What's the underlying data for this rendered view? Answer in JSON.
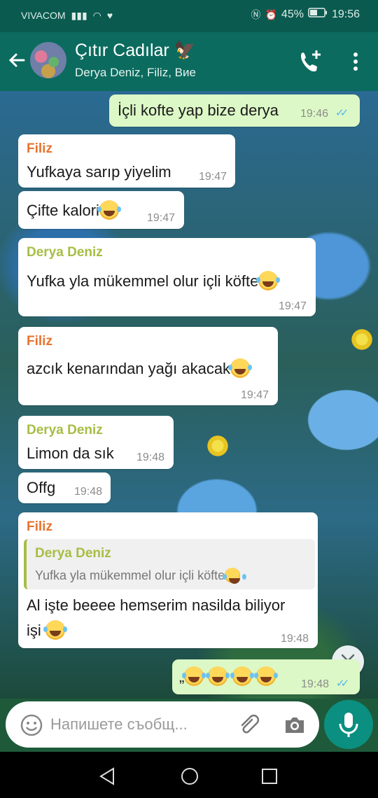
{
  "status_bar": {
    "carrier": "VIVACOM",
    "battery": "45%",
    "time": "19:56"
  },
  "header": {
    "title": "Çıtır Cadılar 🦅",
    "subtitle": "Derya Deniz, Filiz, Вие"
  },
  "messages": [
    {
      "type": "out",
      "text": "İçli kofte yap bize derya",
      "time": "19:46"
    },
    {
      "type": "in",
      "sender": "Filiz",
      "text": "Yufkaya sarıp yiyelim",
      "time": "19:47"
    },
    {
      "type": "in",
      "text": "Çifte kalori",
      "time": "19:47"
    },
    {
      "type": "in",
      "sender": "Derya Deniz",
      "text": "Yufka yla mükemmel olur içli köfte",
      "time": "19:47"
    },
    {
      "type": "in",
      "sender": "Filiz",
      "text": "azcık kenarından yağı akacak",
      "time": "19:47"
    },
    {
      "type": "in",
      "sender": "Derya Deniz",
      "text": "Limon da sık",
      "time": "19:48"
    },
    {
      "type": "in",
      "text": "Offg",
      "time": "19:48"
    },
    {
      "type": "in",
      "sender": "Filiz",
      "quote_name": "Derya Deniz",
      "quote_text": "Yufka yla mükemmel olur içli köfte",
      "text_line1": "Al işte beeee hemserim nasilda biliyor",
      "text_line2": "işi",
      "time": "19:48"
    },
    {
      "type": "out",
      "text": "„",
      "time": "19:48"
    }
  ],
  "input": {
    "placeholder": "Напишете съобщ..."
  },
  "colors": {
    "header": "#0b6b5e",
    "out_bubble": "#dcf8c6",
    "in_bubble": "#ffffff",
    "filiz": "#e8732f",
    "derya": "#a7bd45",
    "ticks": "#4fb6ec",
    "mic": "#0b8f80"
  },
  "icons": [
    "back-arrow-icon",
    "add-call-icon",
    "more-vert-icon",
    "double-chevron-down-icon",
    "emoji-icon",
    "paperclip-icon",
    "camera-icon",
    "mic-icon",
    "nav-back-icon",
    "nav-home-icon",
    "nav-recent-icon"
  ]
}
